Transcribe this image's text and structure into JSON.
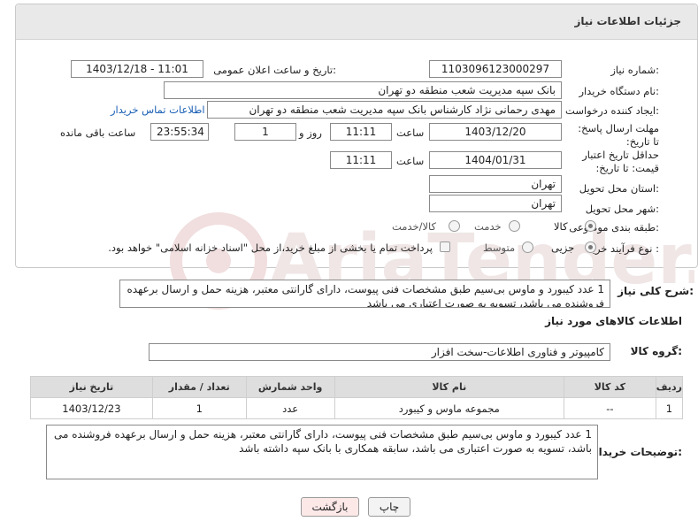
{
  "panel": {
    "title": "جزئیات اطلاعات نیاز"
  },
  "labels": {
    "need_number": "شماره نیاز:",
    "announce_datetime": "تاریخ و ساعت اعلان عمومی:",
    "buyer_name": "نام دستگاه خریدار:",
    "requester": "ایجاد کننده درخواست:",
    "reply_deadline": "مهلت ارسال پاسخ: تا تاریخ:",
    "price_validity": "حداقل تاریخ اعتبار قیمت: تا تاریخ:",
    "province": "استان محل تحویل:",
    "city": "شهر محل تحویل:",
    "category": "طبقه بندی موضوعی:",
    "purchase_type": "نوع فرآیند خرید :",
    "time": "ساعت",
    "day_and": "روز و",
    "remaining": "ساعت باقی مانده",
    "general_desc": "شرح کلی نیاز:",
    "goods_info": "اطلاعات کالاهای مورد نیاز",
    "goods_group": "گروه کالا:",
    "buyer_notes": "توضیحات خریدار:"
  },
  "fields": {
    "need_number": "1103096123000297",
    "announce_datetime": "1403/12/18 - 11:01",
    "buyer_name": "بانک سپه مدیریت شعب منطقه دو تهران",
    "requester": "مهدی رحمانی نژاد کارشناس بانک سپه مدیریت شعب منطقه دو تهران",
    "contact_link": "اطلاعات تماس خریدار",
    "reply_date": "1403/12/20",
    "reply_time": "11:11",
    "days": "1",
    "remaining_time": "23:55:34",
    "validity_date": "1404/01/31",
    "validity_time": "11:11",
    "province": "تهران",
    "city": "تهران",
    "goods_group": "کامپیوتر و فناوری اطلاعات-سخت افزار"
  },
  "category_options": [
    "کالا",
    "خدمت",
    "کالا/خدمت"
  ],
  "purchase_options": [
    "جزیی",
    "متوسط"
  ],
  "payment_note": "پرداخت تمام یا بخشی از مبلغ خرید،از محل \"اسناد خزانه اسلامی\" خواهد بود.",
  "general_description": "1 عدد کیبورد و ماوس بی‌سیم طبق مشخصات فنی پیوست، دارای گارانتی معتبر، هزینه حمل و ارسال برعهده فروشنده می باشد، تسویه به صورت اعتباری می باشد",
  "table": {
    "headers": [
      "ردیف",
      "کد کالا",
      "نام کالا",
      "واحد شمارش",
      "تعداد / مقدار",
      "تاریخ نیاز"
    ],
    "rows": [
      [
        "1",
        "--",
        "مجموعه ماوس و کیبورد",
        "عدد",
        "1",
        "1403/12/23"
      ]
    ]
  },
  "buyer_notes": "1 عدد کیبورد و ماوس بی‌سیم طبق مشخصات فنی پیوست، دارای گارانتی معتبر، هزینه حمل و ارسال برعهده فروشنده می باشد، تسویه به صورت اعتباری می باشد، سابقه همکاری با بانک سپه داشته باشد",
  "buttons": {
    "print": "چاپ",
    "back": "بازگشت"
  },
  "colors": {
    "link": "#1a5fb4",
    "back_button_bg": "#fde8e8",
    "header_bg": "#e9e9e9"
  }
}
